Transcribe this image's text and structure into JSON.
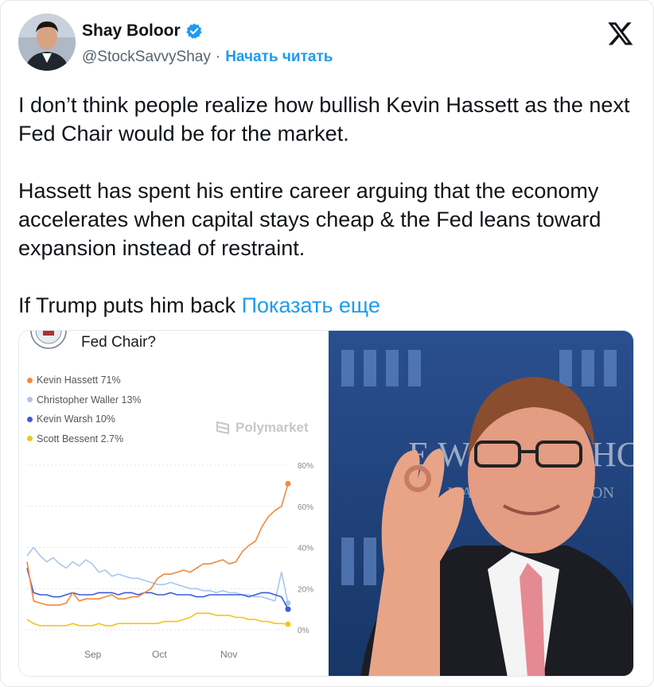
{
  "tweet": {
    "display_name": "Shay Boloor",
    "handle": "@StockSavvyShay",
    "separator": "·",
    "follow_label": "Начать читать",
    "paragraphs": [
      "I don’t think people realize how bullish Kevin Hassett as the next Fed Chair would be for the market.",
      "Hassett has spent his entire career arguing that the economy accelerates when capital stays cheap & the Fed leans toward expansion instead of restraint."
    ],
    "last_line": "If Trump puts him back",
    "show_more_label": "Показать еще"
  },
  "icons": {
    "verified": "verified-badge-icon",
    "logo": "x-logo-icon",
    "brand": "polymarket-logo-icon"
  },
  "colors": {
    "accent": "#1d9bf0",
    "hassett": "#f08a3e",
    "waller": "#a9c7f0",
    "warsh": "#3b5bdb",
    "bessent": "#f5c518"
  },
  "chart_data": {
    "type": "line",
    "title": "Fed Chair?",
    "brand": "Polymarket",
    "x_ticks": [
      "Sep",
      "Oct",
      "Nov"
    ],
    "y_ticks": [
      "80%",
      "60%",
      "40%",
      "20%",
      "0%"
    ],
    "ylim": [
      0,
      80
    ],
    "grid": true,
    "legend_position": "top-left",
    "series": [
      {
        "name": "Kevin Hassett",
        "label": "Kevin Hassett 71%",
        "color": "#f08a3e",
        "values": [
          33,
          14,
          13,
          12,
          12,
          12,
          13,
          18,
          14,
          15,
          15,
          15,
          16,
          17,
          15,
          15,
          16,
          16,
          18,
          20,
          25,
          27,
          27,
          28,
          29,
          28,
          30,
          32,
          32,
          33,
          34,
          32,
          33,
          38,
          41,
          43,
          50,
          55,
          58,
          60,
          71
        ]
      },
      {
        "name": "Christopher Waller",
        "label": "Christopher Waller 13%",
        "color": "#a9c7f0",
        "values": [
          36,
          40,
          36,
          33,
          35,
          32,
          30,
          33,
          31,
          34,
          32,
          28,
          29,
          26,
          27,
          26,
          25,
          25,
          24,
          23,
          22,
          22,
          23,
          22,
          21,
          20,
          20,
          19,
          19,
          18,
          19,
          18,
          18,
          17,
          17,
          16,
          16,
          15,
          14,
          28,
          13
        ]
      },
      {
        "name": "Kevin Warsh",
        "label": "Kevin Warsh 10%",
        "color": "#3b5bdb",
        "values": [
          30,
          18,
          17,
          17,
          16,
          16,
          17,
          18,
          17,
          17,
          17,
          18,
          18,
          18,
          17,
          18,
          18,
          17,
          18,
          18,
          17,
          17,
          18,
          17,
          17,
          17,
          16,
          16,
          17,
          17,
          17,
          17,
          17,
          17,
          16,
          17,
          18,
          18,
          17,
          16,
          10
        ]
      },
      {
        "name": "Scott Bessent",
        "label": "Scott Bessent 2.7%",
        "color": "#f5c518",
        "values": [
          5,
          3,
          2,
          2,
          2,
          2,
          2,
          3,
          2,
          2,
          2,
          3,
          2,
          2,
          3,
          3,
          3,
          3,
          3,
          3,
          3,
          4,
          4,
          4,
          5,
          6,
          8,
          8,
          8,
          7,
          7,
          7,
          6,
          6,
          5,
          5,
          4,
          4,
          3,
          3,
          2.7
        ]
      }
    ]
  }
}
